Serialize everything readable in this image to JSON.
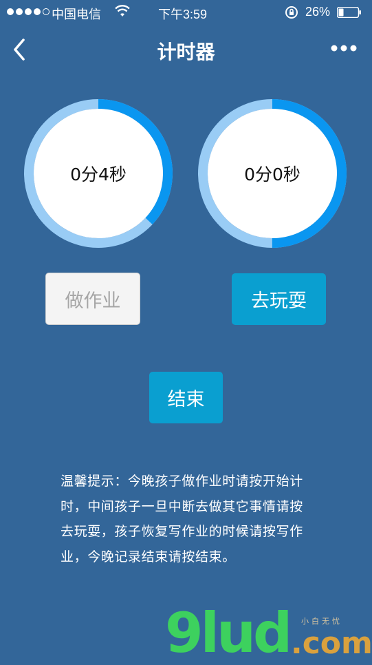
{
  "status_bar": {
    "carrier": "中国电信",
    "time": "下午3:59",
    "battery_percent": "26%",
    "battery_level": 0.26,
    "signal_bars_filled": 4,
    "signal_bars_total": 5
  },
  "header": {
    "title": "计时器",
    "back_icon": "chevron-left-icon",
    "more_icon": "more-dots-icon"
  },
  "timers": [
    {
      "name": "homework",
      "display": "0分4秒",
      "progress": 0.37,
      "ring_color": "#0a96f0",
      "track_color": "#99ccf5"
    },
    {
      "name": "play",
      "display": "0分0秒",
      "progress": 0.5,
      "ring_color": "#0a96f0",
      "track_color": "#99ccf5"
    }
  ],
  "buttons": {
    "homework_label": "做作业",
    "play_label": "去玩耍",
    "end_label": "结束"
  },
  "tip": {
    "text": "温馨提示：今晚孩子做作业时请按开始计时，中间孩子一旦中断去做其它事情请按去玩耍，孩子恢复写作业的时候请按写作业，今晚记录结束请按结束。"
  },
  "watermark": {
    "main": "9lud",
    "suffix": ".com",
    "small": "小白无忧"
  },
  "colors": {
    "background": "#336699",
    "accent": "#0a9fd0",
    "ring": "#0a96f0",
    "ring_track": "#99ccf5"
  }
}
